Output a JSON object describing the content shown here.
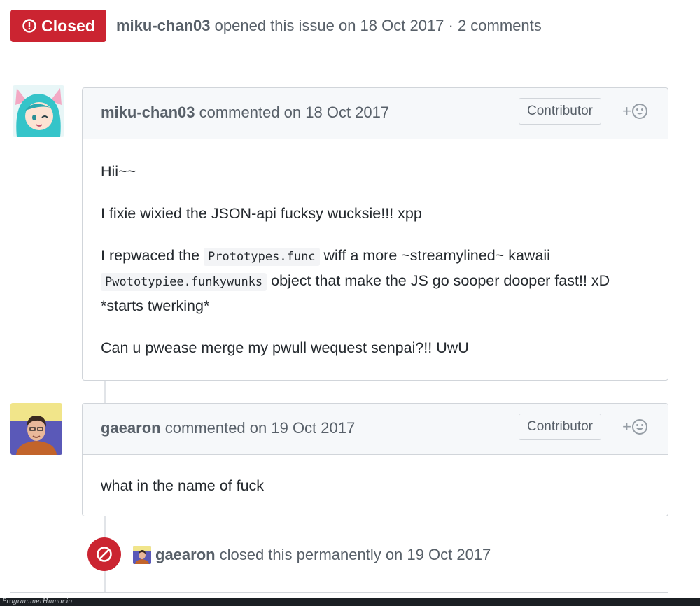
{
  "issue": {
    "state_label": "Closed",
    "author": "miku-chan03",
    "meta": "opened this issue on 18 Oct 2017 · 2 comments"
  },
  "comments": [
    {
      "author": "miku-chan03",
      "meta": "commented on 18 Oct 2017",
      "role": "Contributor",
      "reaction": "+",
      "body": {
        "p1": "Hii~~",
        "p2": "I fixie wixied the JSON-api fucksy wucksie!!! xpp",
        "p3_a": "I repwaced the ",
        "p3_code1": "Prototypes.func",
        "p3_b": " wiff a more ~streamylined~ kawaii ",
        "p3_code2": "Pwototypiee.funkywunks",
        "p3_c": " object that make the JS go sooper dooper fast!! xD *starts twerking*",
        "p4": "Can u pwease merge my pwull wequest senpai?!! UwU"
      }
    },
    {
      "author": "gaearon",
      "meta": "commented on 19 Oct 2017",
      "role": "Contributor",
      "reaction": "+",
      "body": {
        "p1": "what in the name of fuck"
      }
    }
  ],
  "event": {
    "author": "gaearon",
    "text": "closed this permanently on 19 Oct 2017"
  },
  "watermark": "ProgrammerHumor.io",
  "colors": {
    "closed_red": "#cb2431",
    "muted_text": "#586069",
    "border": "#d1d5da"
  }
}
